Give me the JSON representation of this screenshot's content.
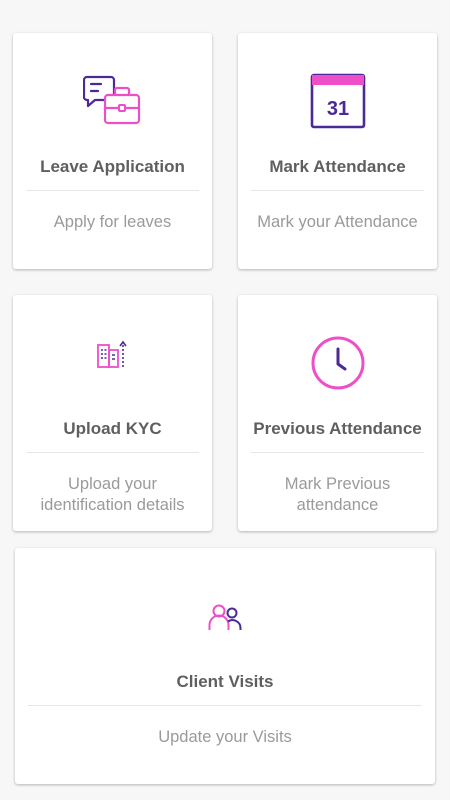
{
  "colors": {
    "accent_pink": "#ee4fc8",
    "accent_purple": "#4b2a96",
    "background": "#f7f7f7",
    "card": "#ffffff",
    "title_text": "#5f5f5f",
    "description_text": "#9a9a9a"
  },
  "cards": [
    {
      "id": "leave-application",
      "icon": "chat-briefcase-icon",
      "title": "Leave Application",
      "description": "Apply for leaves"
    },
    {
      "id": "mark-attendance",
      "icon": "calendar-31-icon",
      "title": "Mark Attendance",
      "description": "Mark your Attendance",
      "icon_text": "31"
    },
    {
      "id": "upload-kyc",
      "icon": "buildings-upload-icon",
      "title": "Upload KYC",
      "description": "Upload your identification details"
    },
    {
      "id": "previous-attendance",
      "icon": "clock-icon",
      "title": "Previous Attendance",
      "description": "Mark Previous attendance"
    },
    {
      "id": "client-visits",
      "icon": "users-icon",
      "title": "Client Visits",
      "description": "Update your Visits"
    }
  ]
}
